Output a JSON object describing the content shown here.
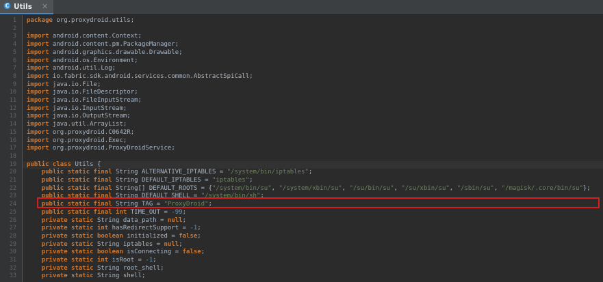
{
  "tab": {
    "label": "Utils",
    "close": "✕",
    "icon": "class-file-icon"
  },
  "code_lines": [
    {
      "n": "1",
      "p": [
        [
          "k",
          "package"
        ],
        [
          "t",
          " org.proxydroid.utils;"
        ]
      ]
    },
    {
      "n": "2",
      "p": []
    },
    {
      "n": "3",
      "p": [
        [
          "k",
          "import"
        ],
        [
          "t",
          " android.content.Context;"
        ]
      ]
    },
    {
      "n": "4",
      "p": [
        [
          "k",
          "import"
        ],
        [
          "t",
          " android.content.pm.PackageManager;"
        ]
      ]
    },
    {
      "n": "5",
      "p": [
        [
          "k",
          "import"
        ],
        [
          "t",
          " android.graphics.drawable.Drawable;"
        ]
      ]
    },
    {
      "n": "6",
      "p": [
        [
          "k",
          "import"
        ],
        [
          "t",
          " android.os.Environment;"
        ]
      ]
    },
    {
      "n": "7",
      "p": [
        [
          "k",
          "import"
        ],
        [
          "t",
          " android.util.Log;"
        ]
      ]
    },
    {
      "n": "8",
      "p": [
        [
          "k",
          "import"
        ],
        [
          "t",
          " io.fabric.sdk.android.services.common.AbstractSpiCall;"
        ]
      ]
    },
    {
      "n": "9",
      "p": [
        [
          "k",
          "import"
        ],
        [
          "t",
          " java.io.File;"
        ]
      ]
    },
    {
      "n": "10",
      "p": [
        [
          "k",
          "import"
        ],
        [
          "t",
          " java.io.FileDescriptor;"
        ]
      ]
    },
    {
      "n": "11",
      "p": [
        [
          "k",
          "import"
        ],
        [
          "t",
          " java.io.FileInputStream;"
        ]
      ]
    },
    {
      "n": "12",
      "p": [
        [
          "k",
          "import"
        ],
        [
          "t",
          " java.io.InputStream;"
        ]
      ]
    },
    {
      "n": "13",
      "p": [
        [
          "k",
          "import"
        ],
        [
          "t",
          " java.io.OutputStream;"
        ]
      ]
    },
    {
      "n": "14",
      "p": [
        [
          "k",
          "import"
        ],
        [
          "t",
          " java.util.ArrayList;"
        ]
      ]
    },
    {
      "n": "15",
      "p": [
        [
          "k",
          "import"
        ],
        [
          "t",
          " org.proxydroid.C0642R;"
        ]
      ]
    },
    {
      "n": "16",
      "p": [
        [
          "k",
          "import"
        ],
        [
          "t",
          " org.proxydroid.Exec;"
        ]
      ]
    },
    {
      "n": "17",
      "p": [
        [
          "k",
          "import"
        ],
        [
          "t",
          " org.proxydroid.ProxyDroidService;"
        ]
      ]
    },
    {
      "n": "18",
      "p": []
    },
    {
      "n": "19",
      "p": [
        [
          "k",
          "public class"
        ],
        [
          "t",
          " Utils {"
        ]
      ]
    },
    {
      "n": "20",
      "p": [
        [
          "t",
          "    "
        ],
        [
          "k",
          "public static final"
        ],
        [
          "t",
          " String ALTERNATIVE_IPTABLES = "
        ],
        [
          "s",
          "\"/system/bin/iptables\""
        ],
        [
          "t",
          ";"
        ]
      ]
    },
    {
      "n": "21",
      "p": [
        [
          "t",
          "    "
        ],
        [
          "k",
          "public static final"
        ],
        [
          "t",
          " String DEFAULT_IPTABLES = "
        ],
        [
          "s",
          "\"iptables\""
        ],
        [
          "t",
          ";"
        ]
      ]
    },
    {
      "n": "22",
      "p": [
        [
          "t",
          "    "
        ],
        [
          "k",
          "public static final"
        ],
        [
          "t",
          " String[] DEFAULT_ROOTS = {"
        ],
        [
          "s",
          "\"/system/bin/su\""
        ],
        [
          "t",
          ", "
        ],
        [
          "s",
          "\"/system/xbin/su\""
        ],
        [
          "t",
          ", "
        ],
        [
          "s",
          "\"/su/bin/su\""
        ],
        [
          "t",
          ", "
        ],
        [
          "s",
          "\"/su/xbin/su\""
        ],
        [
          "t",
          ", "
        ],
        [
          "s",
          "\"/sbin/su\""
        ],
        [
          "t",
          ", "
        ],
        [
          "s",
          "\"/magisk/.core/bin/su\""
        ],
        [
          "t",
          "};"
        ]
      ]
    },
    {
      "n": "23",
      "p": [
        [
          "t",
          "    "
        ],
        [
          "k",
          "public static final"
        ],
        [
          "t",
          " String DEFAULT_SHELL = "
        ],
        [
          "s",
          "\"/system/bin/sh\""
        ],
        [
          "t",
          ";"
        ]
      ]
    },
    {
      "n": "24",
      "p": [
        [
          "t",
          "    "
        ],
        [
          "k",
          "public static final"
        ],
        [
          "t",
          " String TAG = "
        ],
        [
          "s",
          "\"ProxyDroid\""
        ],
        [
          "t",
          ";"
        ]
      ]
    },
    {
      "n": "25",
      "p": [
        [
          "t",
          "    "
        ],
        [
          "k",
          "public static final int"
        ],
        [
          "t",
          " TIME_OUT = "
        ],
        [
          "n",
          "-99"
        ],
        [
          "t",
          ";"
        ]
      ]
    },
    {
      "n": "26",
      "p": [
        [
          "t",
          "    "
        ],
        [
          "k",
          "private static"
        ],
        [
          "t",
          " String data_path = "
        ],
        [
          "k",
          "null"
        ],
        [
          "t",
          ";"
        ]
      ]
    },
    {
      "n": "27",
      "p": [
        [
          "t",
          "    "
        ],
        [
          "k",
          "private static int"
        ],
        [
          "t",
          " hasRedirectSupport = "
        ],
        [
          "n",
          "-1"
        ],
        [
          "t",
          ";"
        ]
      ]
    },
    {
      "n": "28",
      "p": [
        [
          "t",
          "    "
        ],
        [
          "k",
          "private static boolean"
        ],
        [
          "t",
          " initialized = "
        ],
        [
          "k",
          "false"
        ],
        [
          "t",
          ";"
        ]
      ]
    },
    {
      "n": "29",
      "p": [
        [
          "t",
          "    "
        ],
        [
          "k",
          "private static"
        ],
        [
          "t",
          " String iptables = "
        ],
        [
          "k",
          "null"
        ],
        [
          "t",
          ";"
        ]
      ]
    },
    {
      "n": "30",
      "p": [
        [
          "t",
          "    "
        ],
        [
          "k",
          "private static boolean"
        ],
        [
          "t",
          " isConnecting = "
        ],
        [
          "k",
          "false"
        ],
        [
          "t",
          ";"
        ]
      ]
    },
    {
      "n": "31",
      "p": [
        [
          "t",
          "    "
        ],
        [
          "k",
          "private static int"
        ],
        [
          "t",
          " isRoot = "
        ],
        [
          "n",
          "-1"
        ],
        [
          "t",
          ";"
        ]
      ]
    },
    {
      "n": "32",
      "p": [
        [
          "t",
          "    "
        ],
        [
          "k",
          "private static"
        ],
        [
          "t",
          " String root_shell;"
        ]
      ]
    },
    {
      "n": "33",
      "p": [
        [
          "t",
          "    "
        ],
        [
          "k",
          "private static"
        ],
        [
          "t",
          " String shell;"
        ]
      ]
    }
  ],
  "current_line": "19",
  "highlighted_line": "22",
  "colors": {
    "keyword": "#cc7832",
    "string": "#6a8759",
    "number": "#6897bb",
    "text": "#a9b7c6",
    "line_number": "#606366",
    "highlight_border": "#d42020"
  }
}
